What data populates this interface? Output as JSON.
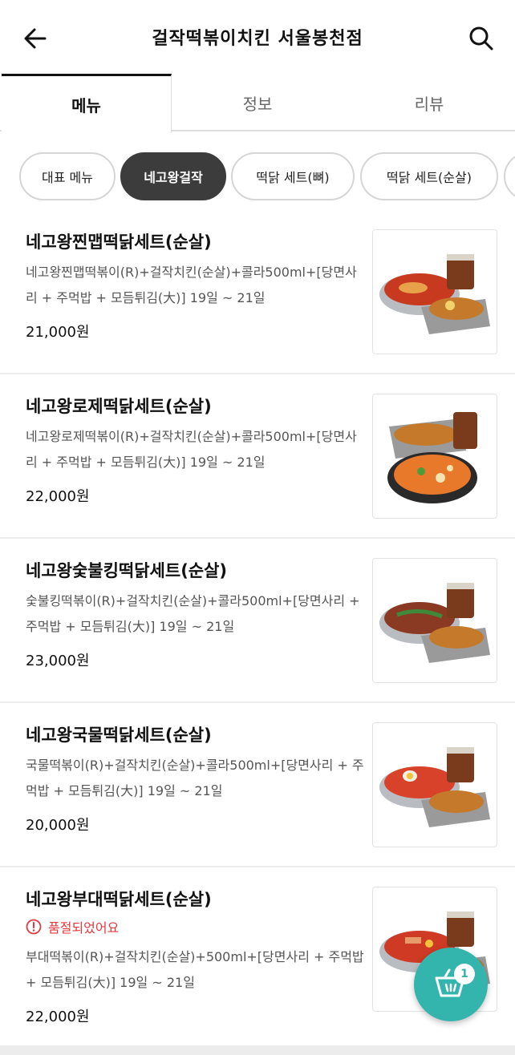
{
  "header": {
    "title": "걸작떡볶이치킨 서울봉천점",
    "back_icon": "arrow-left-icon",
    "search_icon": "search-icon"
  },
  "tabs": [
    {
      "label": "메뉴",
      "active": true
    },
    {
      "label": "정보",
      "active": false
    },
    {
      "label": "리뷰",
      "active": false
    }
  ],
  "chips": [
    {
      "label": "대표 메뉴",
      "active": false
    },
    {
      "label": "네고왕걸작",
      "active": true
    },
    {
      "label": "떡닭 세트(뼈)",
      "active": false
    },
    {
      "label": "떡닭 세트(순살)",
      "active": false
    }
  ],
  "menu_items": [
    {
      "name": "네고왕찐맵떡닭세트(순살)",
      "desc": "네고왕찐맵떡볶이(R)+걸작치킨(순살)+콜라500ml+[당면사리 + 주먹밥 + 모듬튀김(大)] 19일 ~ 21일",
      "price": "21,000원",
      "soldout": ""
    },
    {
      "name": "네고왕로제떡닭세트(순살)",
      "desc": "네고왕로제떡볶이(R)+걸작치킨(순살)+콜라500ml+[당면사리 + 주먹밥 + 모듬튀김(大)] 19일 ~ 21일",
      "price": "22,000원",
      "soldout": ""
    },
    {
      "name": "네고왕숯불킹떡닭세트(순살)",
      "desc": "숯불킹떡볶이(R)+걸작치킨(순살)+콜라500ml+[당면사리 + 주먹밥 + 모듬튀김(大)] 19일 ~ 21일",
      "price": "23,000원",
      "soldout": ""
    },
    {
      "name": "네고왕국물떡닭세트(순살)",
      "desc": "국물떡볶이(R)+걸작치킨(순살)+콜라500ml+[당면사리 + 주먹밥 + 모듬튀김(大)] 19일 ~ 21일",
      "price": "20,000원",
      "soldout": ""
    },
    {
      "name": "네고왕부대떡닭세트(순살)",
      "desc": "부대떡볶이(R)+걸작치킨(순살)+500ml+[당면사리 + 주먹밥 + 모듬튀김(大)] 19일 ~ 21일",
      "price": "22,000원",
      "soldout": "품절되었어요"
    }
  ],
  "cart": {
    "count": "1",
    "icon": "cart-icon"
  },
  "colors": {
    "accent": "#33b5ad",
    "soldout": "#e0393e",
    "chip_active": "#3c3c3c"
  }
}
